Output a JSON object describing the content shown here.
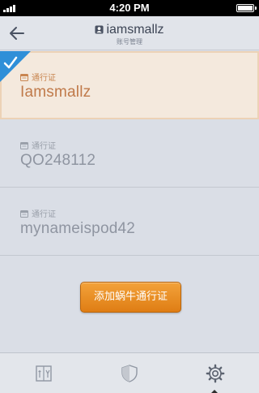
{
  "status_bar": {
    "time": "4:20 PM"
  },
  "nav": {
    "title": "iamsmallz",
    "subtitle": "账号管理",
    "back_icon": "back-arrow-icon"
  },
  "accounts": [
    {
      "label": "通行证",
      "name": "Iamsmallz",
      "selected": true
    },
    {
      "label": "通行证",
      "name": "QO248112",
      "selected": false
    },
    {
      "label": "通行证",
      "name": "mynameispod42",
      "selected": false
    }
  ],
  "add_button": {
    "label": "添加蜗牛通行证"
  },
  "tabs": [
    {
      "icon": "passport-icon",
      "active": false
    },
    {
      "icon": "shield-icon",
      "active": false
    },
    {
      "icon": "gear-icon",
      "active": true
    }
  ],
  "colors": {
    "accent": "#e48a20",
    "selected_bg": "#f4e9dd",
    "selected_text": "#c07a4a",
    "corner_badge": "#2f8fd8"
  }
}
